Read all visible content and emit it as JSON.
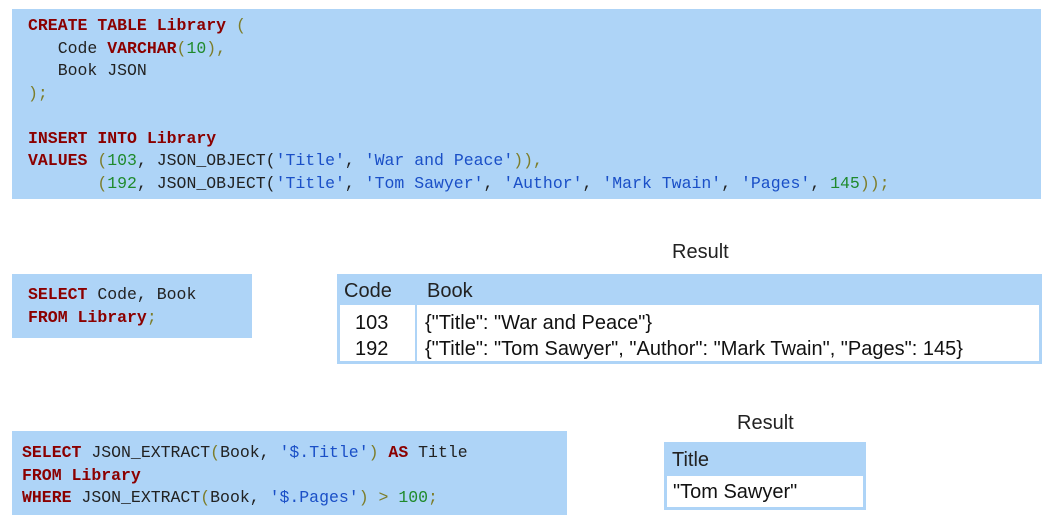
{
  "create_block": {
    "l1_create": "CREATE",
    "l1_table": "TABLE",
    "l1_name": "Library",
    "l1_open": "(",
    "l2_col": "Code",
    "l2_type": "VARCHAR",
    "l2_open": "(",
    "l2_num": "10",
    "l2_close": "),",
    "l3_text": "Book JSON",
    "l4_close": ");",
    "l6_insert": "INSERT",
    "l6_into": "INTO",
    "l6_name": "Library",
    "l7_values": "VALUES",
    "l7_open": "(",
    "l7_num": "103",
    "l7_a": ", JSON_OBJECT(",
    "l7_s1": "'Title'",
    "l7_c1": ", ",
    "l7_s2": "'War and Peace'",
    "l7_close": ")),",
    "l8_open": "(",
    "l8_num": "192",
    "l8_a": ", JSON_OBJECT(",
    "l8_s1": "'Title'",
    "l8_c1": ", ",
    "l8_s2": "'Tom Sawyer'",
    "l8_c2": ", ",
    "l8_s3": "'Author'",
    "l8_c3": ", ",
    "l8_s4": "'Mark Twain'",
    "l8_c4": ", ",
    "l8_s5": "'Pages'",
    "l8_c5": ", ",
    "l8_num2": "145",
    "l8_close": "));"
  },
  "select_block_1": {
    "l1_select": "SELECT",
    "l1_rest": " Code, Book",
    "l2_from": "FROM",
    "l2_name": "Library",
    "l2_semi": ";"
  },
  "select_block_2": {
    "l1_select": "SELECT",
    "l1_a": " JSON_EXTRACT",
    "l1_open": "(",
    "l1_b": "Book, ",
    "l1_s": "'$.Title'",
    "l1_close": ")",
    "l1_as": "AS",
    "l1_c": " Title",
    "l2_from": "FROM",
    "l2_name": "Library",
    "l3_where": "WHERE",
    "l3_a": " JSON_EXTRACT",
    "l3_open": "(",
    "l3_b": "Book, ",
    "l3_s": "'$.Pages'",
    "l3_close": ")",
    "l3_gt": " > ",
    "l3_num": "100",
    "l3_semi": ";"
  },
  "result_1": {
    "label": "Result",
    "columns": [
      "Code",
      "Book"
    ],
    "rows": [
      [
        "103",
        "{\"Title\": \"War and Peace\"}"
      ],
      [
        "192",
        "{\"Title\": \"Tom Sawyer\", \"Author\": \"Mark Twain\", \"Pages\": 145}"
      ]
    ]
  },
  "result_2": {
    "label": "Result",
    "columns": [
      "Title"
    ],
    "rows": [
      [
        "\"Tom Sawyer\""
      ]
    ]
  }
}
